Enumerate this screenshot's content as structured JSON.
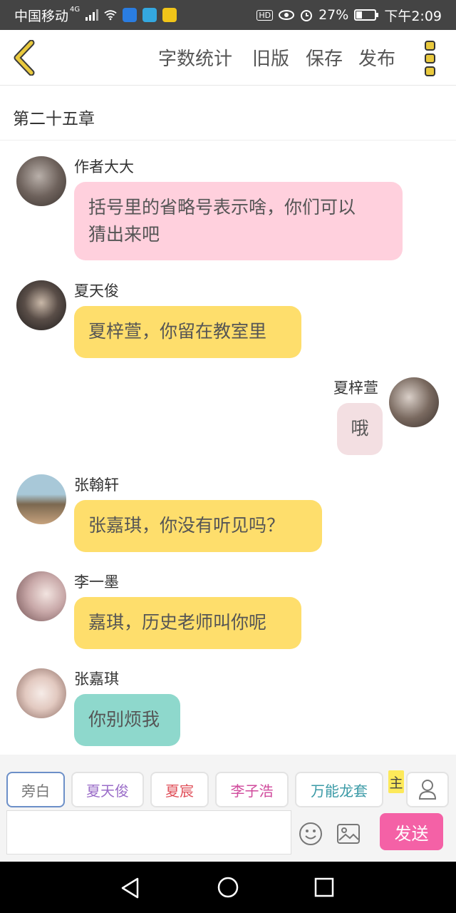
{
  "status_bar": {
    "carrier": "中国移动",
    "network": "4G",
    "battery": "27%",
    "time": "下午2:09"
  },
  "header": {
    "word_count": "字数统计",
    "old_version": "旧版",
    "save": "保存",
    "publish": "发布"
  },
  "chapter_title": "第二十五章",
  "messages": [
    {
      "sender": "作者大大",
      "text_line1": "括号里的省略号表示啥，你们可以",
      "text_line2": "猜出来吧",
      "bubble_color": "#ffd0dd",
      "side": "left"
    },
    {
      "sender": "夏天俊",
      "text": "夏梓萱，你留在教室里",
      "bubble_color": "#fede6c",
      "side": "left"
    },
    {
      "sender": "夏梓萱",
      "text": "哦",
      "bubble_color": "#f3dfe2",
      "side": "right"
    },
    {
      "sender": "张翰轩",
      "text": "张嘉琪，你没有听见吗？",
      "bubble_color": "#fede6c",
      "side": "left"
    },
    {
      "sender": "李一墨",
      "text": "嘉琪，历史老师叫你呢",
      "bubble_color": "#fede6c",
      "side": "left"
    },
    {
      "sender": "张嘉琪",
      "text": "你别烦我",
      "bubble_color": "#8ed8cc",
      "side": "left"
    }
  ],
  "role_chips": [
    {
      "label": "旁白",
      "color": "#777777"
    },
    {
      "label": "夏天俊",
      "color": "#9a6cc8"
    },
    {
      "label": "夏宸",
      "color": "#e0505a"
    },
    {
      "label": "李子浩",
      "color": "#d04a9c"
    },
    {
      "label": "万能龙套",
      "color": "#3a9aa6"
    },
    {
      "label": "主",
      "color": "#444444"
    }
  ],
  "input": {
    "placeholder": "",
    "value": ""
  },
  "send_label": "发送",
  "colors": {
    "accent": "#f461a6",
    "back_arrow": "#d7b42a"
  },
  "icons": [
    "back-arrow-icon",
    "menu-dots-icon",
    "emoji-icon",
    "image-icon",
    "person-icon",
    "back-nav-icon",
    "home-nav-icon",
    "recents-nav-icon"
  ]
}
